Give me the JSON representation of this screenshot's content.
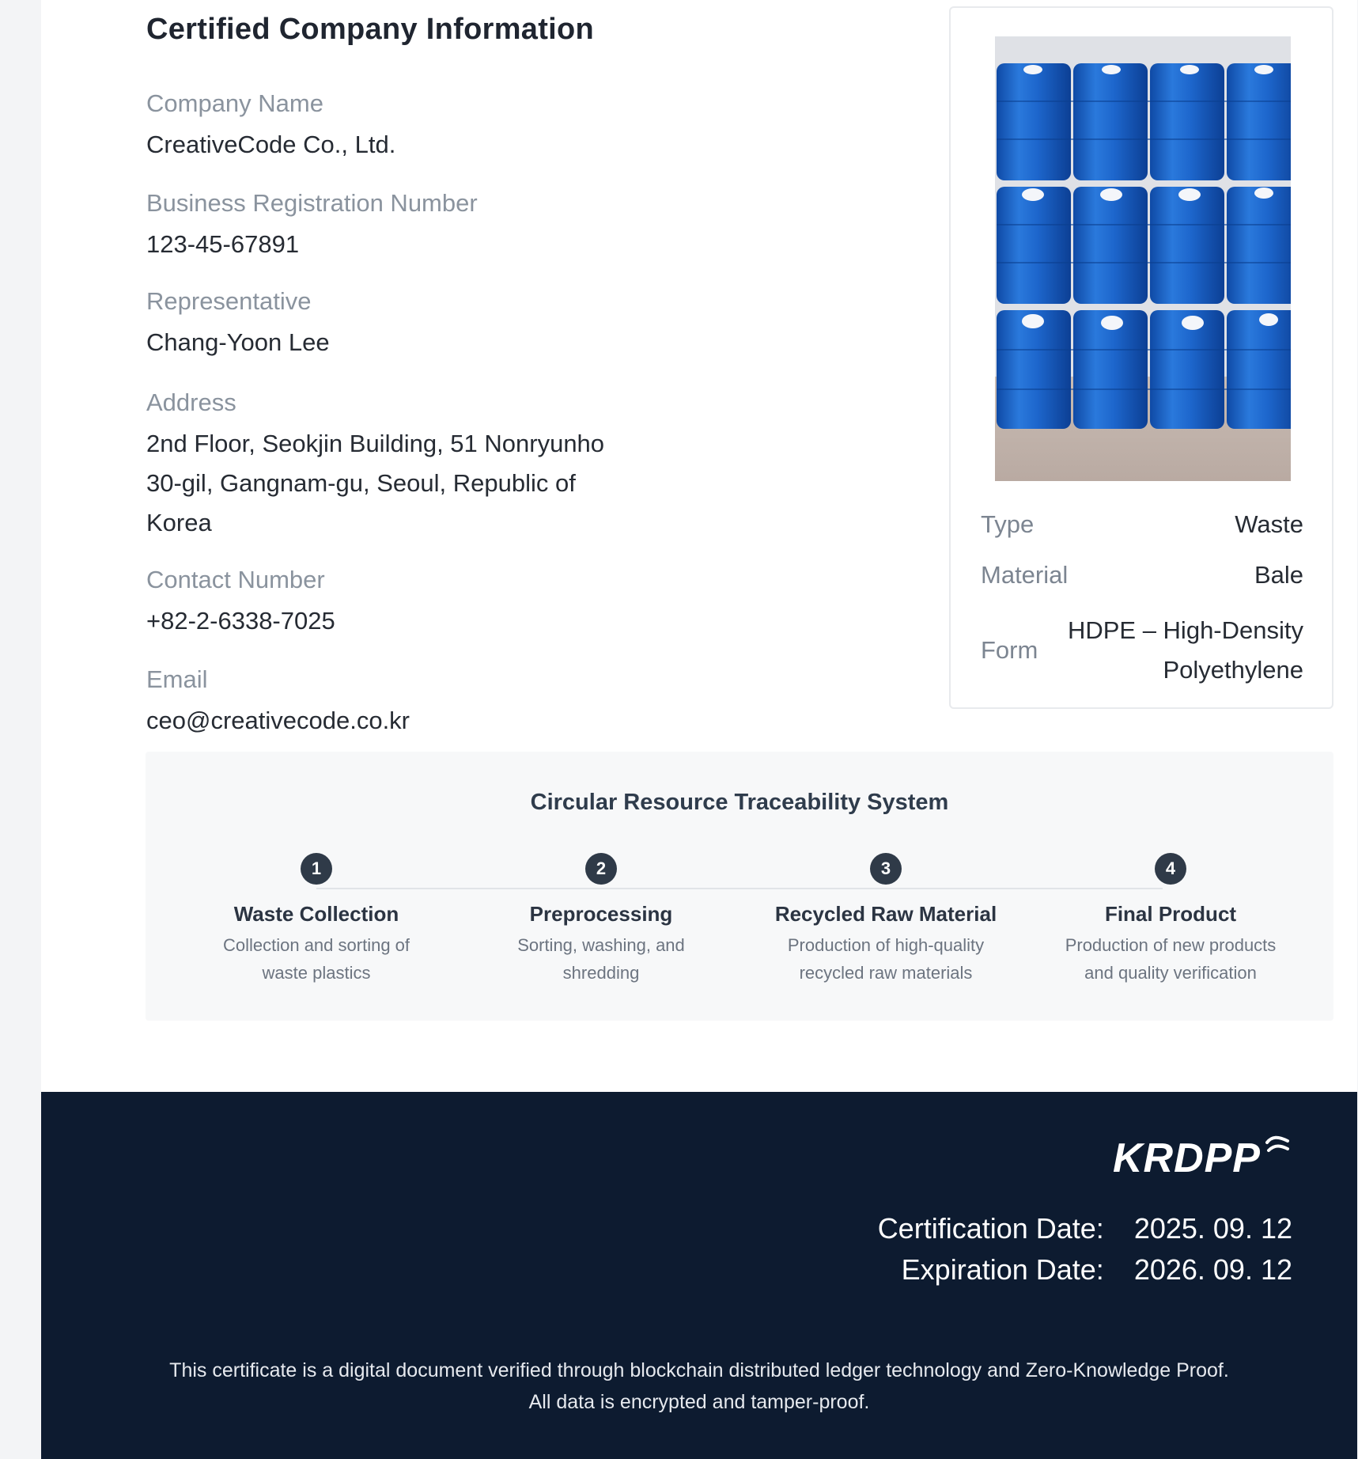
{
  "company": {
    "title": "Certified Company Information",
    "fields": [
      {
        "label": "Company Name",
        "value": "CreativeCode Co., Ltd."
      },
      {
        "label": "Business Registration Number",
        "value": "123-45-67891"
      },
      {
        "label": "Representative",
        "value": "Chang-Yoon Lee"
      },
      {
        "label": "Address",
        "value_lines": [
          "2nd Floor, Seokjin Building, 51 Nonryunho",
          "30-gil, Gangnam-gu, Seoul, Republic of",
          "Korea"
        ]
      },
      {
        "label": "Contact Number",
        "value": "+82-2-6338-7025"
      },
      {
        "label": "Email",
        "value": "ceo@creativecode.co.kr"
      }
    ]
  },
  "product": {
    "image_icon": "blue-plastic-drums-photo",
    "specs": [
      {
        "key": "Type",
        "value": "Waste"
      },
      {
        "key": "Material",
        "value": "Bale"
      },
      {
        "key": "Form",
        "value_lines": [
          "HDPE – High-Density",
          "Polyethylene"
        ]
      }
    ]
  },
  "traceability": {
    "title": "Circular Resource Traceability System",
    "steps": [
      {
        "num": "1",
        "title": "Waste Collection",
        "desc_lines": [
          "Collection and sorting of",
          "waste plastics"
        ]
      },
      {
        "num": "2",
        "title": "Preprocessing",
        "desc_lines": [
          "Sorting, washing, and",
          "shredding"
        ]
      },
      {
        "num": "3",
        "title": "Recycled Raw Material",
        "desc_lines": [
          "Production of high-quality",
          "recycled raw materials"
        ]
      },
      {
        "num": "4",
        "title": "Final Product",
        "desc_lines": [
          "Production of new products",
          "and quality verification"
        ]
      }
    ]
  },
  "footer": {
    "brand": "KRDPP",
    "brand_icon": "wave-icon",
    "certification_label": "Certification Date:",
    "certification_date": "2025. 09. 12",
    "expiration_label": "Expiration Date:",
    "expiration_date": "2026. 09. 12",
    "notice_lines": [
      "This certificate is a digital document verified through blockchain distributed ledger technology and Zero-Knowledge Proof.",
      "All data is encrypted and tamper-proof."
    ]
  },
  "colors": {
    "footer_bg": "#0d1b30",
    "drum_blue": "#1f63c9",
    "step_badge": "#2f3a48"
  }
}
